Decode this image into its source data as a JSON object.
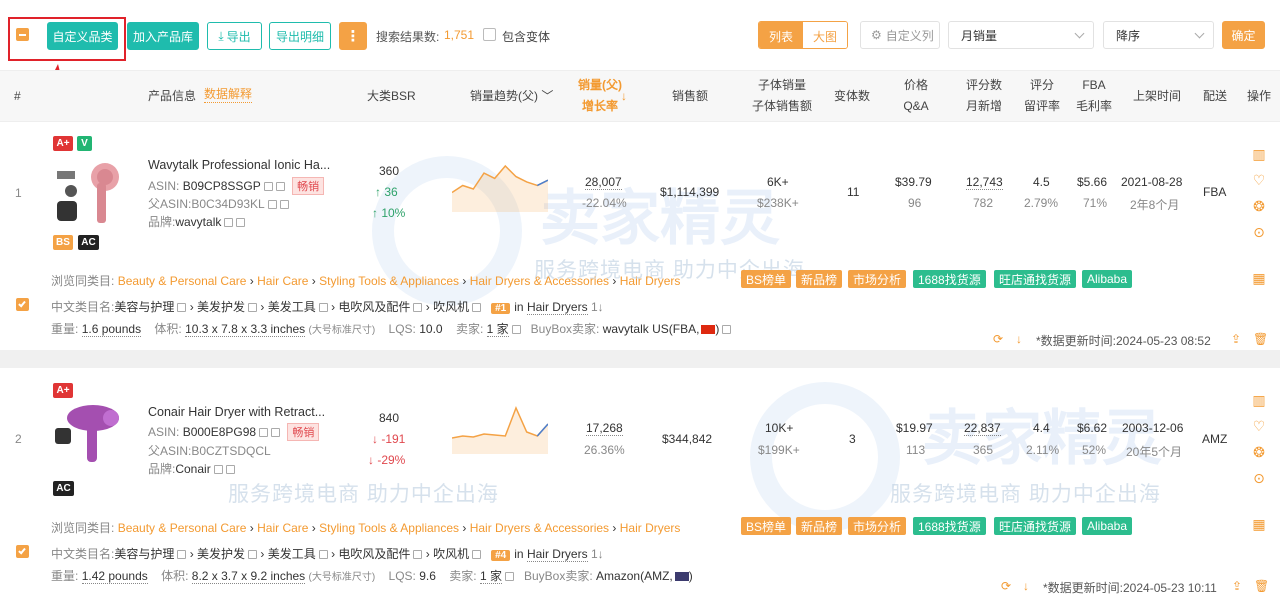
{
  "toolbar": {
    "custom_category_label": "自定义品类",
    "add_to_library_label": "加入产品库",
    "export_label": "导出",
    "export_detail_label": "导出明细",
    "more_label": "⋮",
    "result_count_label": "搜索结果数:",
    "result_count_value": "1,751",
    "include_variants_label": "包含变体",
    "view_list_label": "列表",
    "view_grid_label": "大图",
    "custom_column_label": "自定义列",
    "sort_field_value": "月销量",
    "sort_order_value": "降序",
    "confirm_label": "确定"
  },
  "columns": {
    "index": "#",
    "product_info": "产品信息",
    "data_explain": "数据解释",
    "bsr": "大类BSR",
    "sales_trend": "销量趋势(父)",
    "sales_volume": "销量(父)",
    "growth_rate": "增长率",
    "revenue": "销售额",
    "child_sales": "子体销量",
    "child_revenue": "子体销售额",
    "variants": "变体数",
    "price": "价格",
    "qa": "Q&A",
    "reviews": "评分数",
    "monthly_new": "月新增",
    "rating": "评分",
    "retention": "留评率",
    "fba": "FBA",
    "gross_margin": "毛利率",
    "launch_date": "上架时间",
    "fulfillment": "配送",
    "actions": "操作"
  },
  "watermark": {
    "slogan": "服务跨境电商 助力中企出海",
    "brand": "卖家精灵"
  },
  "products": [
    {
      "index": "1",
      "badges_top": [
        "A+",
        "V"
      ],
      "badges_bottom": [
        "BS",
        "AC"
      ],
      "title": "Wavytalk Professional Ionic Ha...",
      "asin_label": "ASIN:",
      "asin": "B09CP8SSGP",
      "hot_tag": "畅销",
      "parent_asin_label": "父ASIN:",
      "parent_asin": "B0C34D93KL",
      "brand_label": "品牌:",
      "brand": "wavytalk",
      "bsr": "360",
      "bsr_change": "↑ 36",
      "bsr_change_pct": "↑ 10%",
      "bsr_dir": "up",
      "sales": "28,007",
      "growth": "-22.04%",
      "revenue": "$1,114,399",
      "child_sales": "6K+",
      "child_revenue": "$238K+",
      "variants": "11",
      "price": "$39.79",
      "qa": "96",
      "reviews": "12,743",
      "monthly_new": "782",
      "rating": "4.5",
      "retention": "2.79%",
      "fba": "$5.66",
      "margin": "71%",
      "launch_date": "2021-08-28",
      "age": "2年8个月",
      "fulfillment": "FBA",
      "trend": [
        22,
        30,
        26,
        44,
        38,
        52,
        40,
        34,
        30,
        36
      ],
      "browse_label": "浏览同类目:",
      "browse_path": [
        "Beauty & Personal Care",
        "Hair Care",
        "Styling Tools & Appliances",
        "Hair Dryers & Accessories",
        "Hair Dryers"
      ],
      "pills": [
        "BS榜单",
        "新品榜",
        "市场分析",
        "1688找货源",
        "旺店通找货源",
        "Alibaba"
      ],
      "cn_label": "中文类目名:",
      "cn_path": [
        "美容与护理",
        "美发护发",
        "美发工具",
        "电吹风及配件",
        "吹风机"
      ],
      "rank": "#1",
      "rank_in": "in",
      "rank_category": "Hair Dryers",
      "weight_label": "重量:",
      "weight": "1.6 pounds",
      "size_label": "体积:",
      "size": "10.3 x 7.8 x 3.3 inches",
      "size_tier": "(大号标准尺寸)",
      "lqs_label": "LQS:",
      "lqs": "10.0",
      "sellers_label": "卖家:",
      "sellers": "1 家",
      "buybox_label": "BuyBox卖家:",
      "buybox": "wavytalk US(FBA,",
      "updated": "*数据更新时间:2024-05-23 08:52"
    },
    {
      "index": "2",
      "badges_top": [
        "A+"
      ],
      "badges_bottom": [
        "AC"
      ],
      "title": "Conair Hair Dryer with Retract...",
      "asin_label": "ASIN:",
      "asin": "B000E8PG98",
      "hot_tag": "畅销",
      "parent_asin_label": "父ASIN:",
      "parent_asin": "B0CZTSDQCL",
      "brand_label": "品牌:",
      "brand": "Conair",
      "bsr": "840",
      "bsr_change": "↓ -191",
      "bsr_change_pct": "↓ -29%",
      "bsr_dir": "down",
      "sales": "17,268",
      "growth": "26.36%",
      "revenue": "$344,842",
      "child_sales": "10K+",
      "child_revenue": "$199K+",
      "variants": "3",
      "price": "$19.97",
      "qa": "113",
      "reviews": "22,837",
      "monthly_new": "365",
      "rating": "4.4",
      "retention": "2.11%",
      "fba": "$6.62",
      "margin": "52%",
      "launch_date": "2003-12-06",
      "age": "20年5个月",
      "fulfillment": "AMZ",
      "trend": [
        16,
        18,
        17,
        20,
        19,
        18,
        46,
        22,
        18,
        30
      ],
      "browse_label": "浏览同类目:",
      "browse_path": [
        "Beauty & Personal Care",
        "Hair Care",
        "Styling Tools & Appliances",
        "Hair Dryers & Accessories",
        "Hair Dryers"
      ],
      "pills": [
        "BS榜单",
        "新品榜",
        "市场分析",
        "1688找货源",
        "旺店通找货源",
        "Alibaba"
      ],
      "cn_label": "中文类目名:",
      "cn_path": [
        "美容与护理",
        "美发护发",
        "美发工具",
        "电吹风及配件",
        "吹风机"
      ],
      "rank": "#4",
      "rank_in": "in",
      "rank_category": "Hair Dryers",
      "weight_label": "重量:",
      "weight": "1.42 pounds",
      "size_label": "体积:",
      "size": "8.2 x 3.7 x 9.2 inches",
      "size_tier": "(大号标准尺寸)",
      "lqs_label": "LQS:",
      "lqs": "9.6",
      "sellers_label": "卖家:",
      "sellers": "1 家",
      "buybox_label": "BuyBox卖家:",
      "buybox": "Amazon(AMZ,",
      "updated": "*数据更新时间:2024-05-23 10:11"
    }
  ]
}
